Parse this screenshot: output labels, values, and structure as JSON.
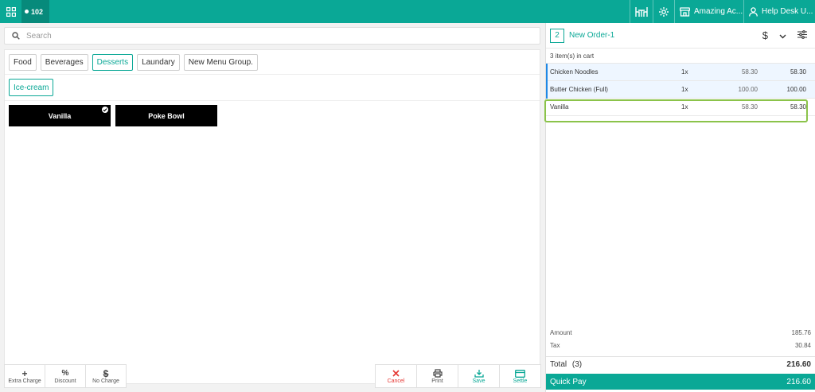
{
  "topbar": {
    "table_number": "102",
    "account_label": "Amazing Ac...",
    "user_label": "Help Desk U..."
  },
  "search": {
    "placeholder": "Search"
  },
  "menu_groups": [
    "Food",
    "Beverages",
    "Desserts",
    "Laundary",
    "New Menu Group."
  ],
  "active_group": "Desserts",
  "subgroups": [
    "Ice-cream"
  ],
  "items": [
    {
      "name": "Vanilla",
      "selected": true
    },
    {
      "name": "Poke Bowl",
      "selected": false
    }
  ],
  "bottom_actions_left": [
    {
      "icon": "+",
      "label": "Extra Charge"
    },
    {
      "icon": "%",
      "label": "Discount"
    },
    {
      "icon": "$",
      "label": "No Charge"
    }
  ],
  "bottom_actions_right": [
    {
      "label": "Cancel"
    },
    {
      "label": "Print"
    },
    {
      "label": "Save"
    },
    {
      "label": "Settle"
    }
  ],
  "order": {
    "count": "2",
    "name": "New Order-1",
    "currency_icon": "$",
    "cart_count": "3 item(s) in cart",
    "lines": [
      {
        "name": "Chicken Noodles",
        "qty": "1x",
        "price": "58.30",
        "total": "58.30"
      },
      {
        "name": "Butter Chicken (Full)",
        "qty": "1x",
        "price": "100.00",
        "total": "100.00"
      },
      {
        "name": "Vanilla",
        "qty": "1x",
        "price": "58.30",
        "total": "58.30"
      }
    ],
    "amount_label": "Amount",
    "amount_value": "185.76",
    "tax_label": "Tax",
    "tax_value": "30.84",
    "total_label": "Total",
    "total_count": "(3)",
    "total_value": "216.60",
    "quickpay_label": "Quick Pay",
    "quickpay_value": "216.60"
  },
  "colors": {
    "accent": "#0aa896",
    "highlight": "#8bc34a",
    "cancel": "#e53935"
  }
}
